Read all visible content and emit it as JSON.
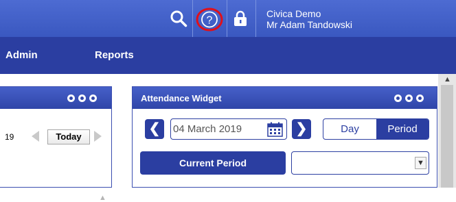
{
  "header": {
    "user_line1": "Civica Demo",
    "user_line2": "Mr Adam Tandowski",
    "help_glyph": "?"
  },
  "nav": {
    "items": [
      {
        "label": "Admin"
      },
      {
        "label": "Reports"
      }
    ]
  },
  "left_widget": {
    "date_fragment": "19",
    "today_label": "Today"
  },
  "attendance_widget": {
    "title": "Attendance Widget",
    "date_value": "04 March 2019",
    "view_day": "Day",
    "view_period": "Period",
    "current_period_label": "Current Period",
    "prev_glyph": "❮",
    "next_glyph": "❯"
  },
  "colors": {
    "topbar": "#3f5cc5",
    "navbar": "#2b3ea1",
    "help_highlight": "#e0101a"
  }
}
